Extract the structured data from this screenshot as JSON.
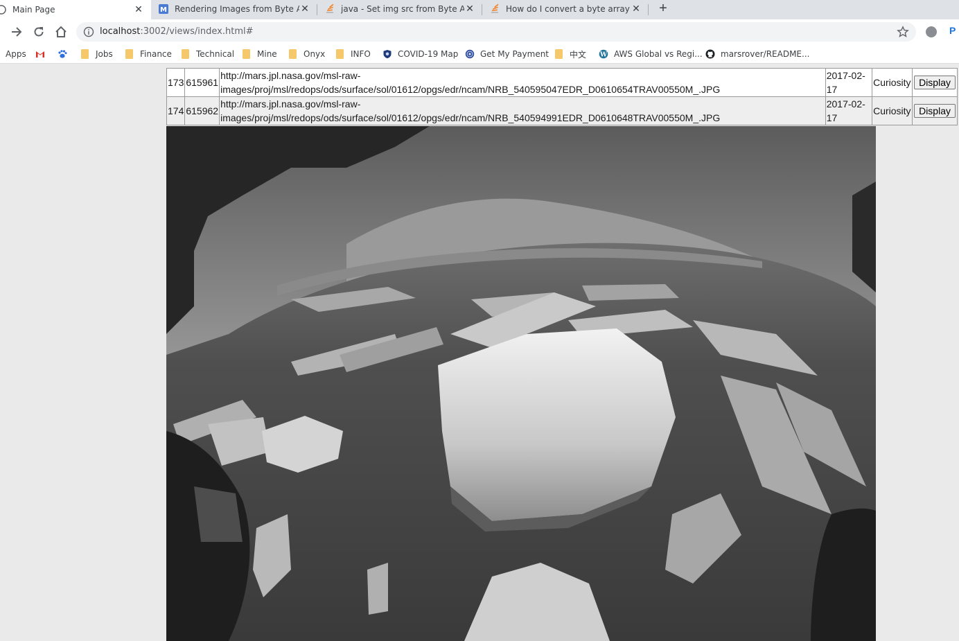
{
  "tabs": [
    {
      "title": "Main Page",
      "active": true,
      "favicon": "page-icon"
    },
    {
      "title": "Rendering Images from Byte Arra",
      "active": false,
      "favicon": "google-docs-icon"
    },
    {
      "title": "java - Set img src from Byte Array",
      "active": false,
      "favicon": "stackoverflow-icon"
    },
    {
      "title": "How do I convert a byte array to",
      "active": false,
      "favicon": "stackoverflow-icon"
    }
  ],
  "toolbar": {
    "url_host": "localhost",
    "url_rest": ":3002/views/index.html#"
  },
  "bookmarks": [
    {
      "label": "Apps",
      "icon": "apps-grid-icon"
    },
    {
      "label": "",
      "icon": "gmail-icon"
    },
    {
      "label": "",
      "icon": "baidu-paw-icon"
    },
    {
      "label": "Jobs",
      "icon": "folder-icon"
    },
    {
      "label": "Finance",
      "icon": "folder-icon"
    },
    {
      "label": "Technical",
      "icon": "folder-icon"
    },
    {
      "label": "Mine",
      "icon": "folder-icon"
    },
    {
      "label": "Onyx",
      "icon": "folder-icon"
    },
    {
      "label": "INFO",
      "icon": "folder-icon"
    },
    {
      "label": "COVID-19 Map",
      "icon": "shield-icon"
    },
    {
      "label": "Get My Payment",
      "icon": "seal-icon"
    },
    {
      "label": "中文",
      "icon": "folder-icon"
    },
    {
      "label": "AWS Global vs Regi...",
      "icon": "wordpress-icon"
    },
    {
      "label": "marsrover/README...",
      "icon": "github-icon"
    }
  ],
  "table": {
    "rows": [
      {
        "index": "173",
        "id": "615961",
        "url_line1": "http://mars.jpl.nasa.gov/msl-raw-",
        "url_line2": "images/proj/msl/redops/ods/surface/sol/01612/opgs/edr/ncam/NRB_540595047EDR_D0610654TRAV00550M_.JPG",
        "date_line1": "2017-02-",
        "date_line2": "17",
        "rover": "Curiosity",
        "action": "Display"
      },
      {
        "index": "174",
        "id": "615962",
        "url_line1": "http://mars.jpl.nasa.gov/msl-raw-",
        "url_line2": "images/proj/msl/redops/ods/surface/sol/01612/opgs/edr/ncam/NRB_540594991EDR_D0610648TRAV00550M_.JPG",
        "date_line1": "2017-02-",
        "date_line2": "17",
        "rover": "Curiosity",
        "action": "Display"
      }
    ]
  }
}
